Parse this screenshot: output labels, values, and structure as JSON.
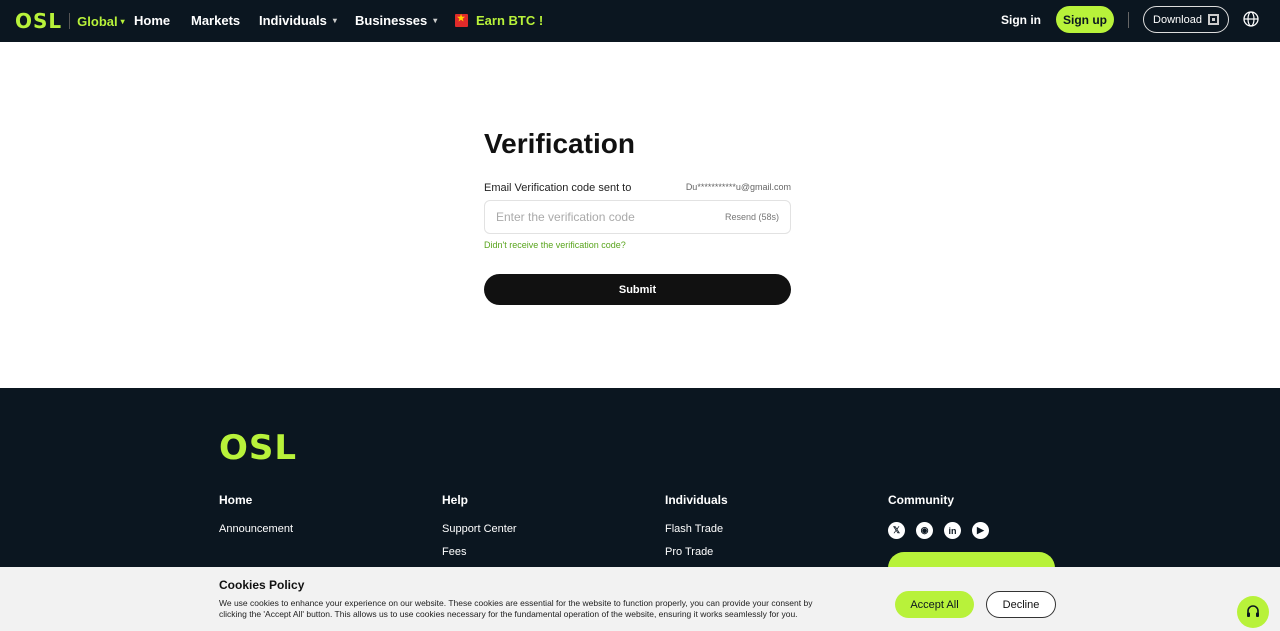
{
  "nav": {
    "logo": "OSL",
    "region": "Global",
    "links": [
      "Home",
      "Markets",
      "Individuals",
      "Businesses"
    ],
    "earn": "Earn BTC !",
    "signin": "Sign in",
    "signup": "Sign up",
    "download": "Download"
  },
  "form": {
    "title": "Verification",
    "sent_label": "Email Verification code sent to",
    "email": "Du***********u@gmail.com",
    "placeholder": "Enter the verification code",
    "resend": "Resend (58s)",
    "didnt_receive": "Didn't receive the verification code?",
    "submit": "Submit"
  },
  "footer": {
    "logo": "OSL",
    "columns": [
      {
        "heading": "Home",
        "items": [
          "Announcement"
        ]
      },
      {
        "heading": "Help",
        "items": [
          "Support Center",
          "Fees"
        ]
      },
      {
        "heading": "Individuals",
        "items": [
          "Flash Trade",
          "Pro Trade"
        ]
      },
      {
        "heading": "Community",
        "items": []
      }
    ],
    "social_icons": [
      "x-icon",
      "discord-icon",
      "linkedin-icon",
      "youtube-icon"
    ]
  },
  "cookies": {
    "title": "Cookies Policy",
    "text": "We use cookies to enhance your experience on our website. These cookies are essential for the website to function properly, you can provide your consent by clicking the 'Accept All' button. This allows us to use cookies necessary for the fundamental operation of the website, ensuring it works seamlessly for you.",
    "accept": "Accept All",
    "decline": "Decline"
  },
  "colors": {
    "brand": "#b8f23a",
    "dark": "#0b1620"
  }
}
